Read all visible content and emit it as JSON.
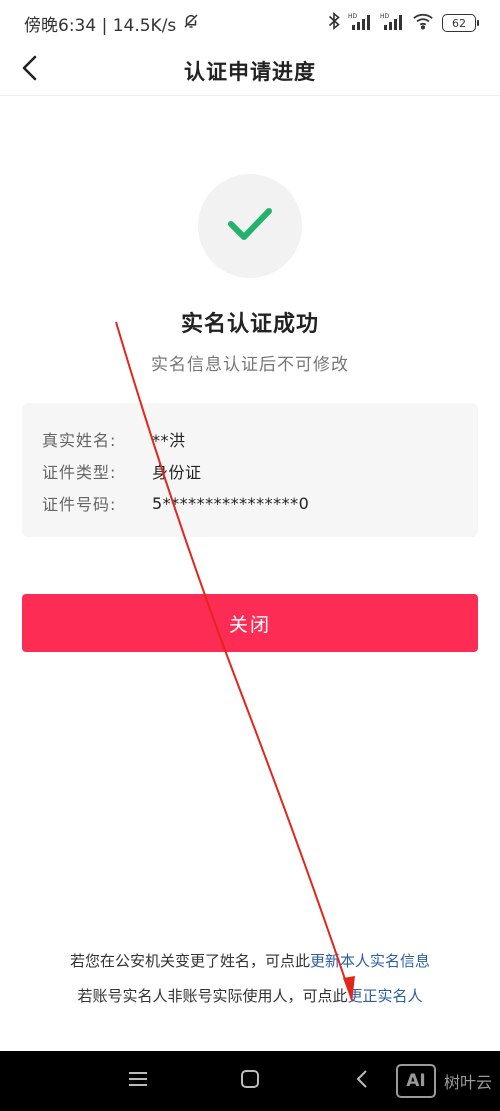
{
  "status_bar": {
    "time_speed": "傍晚6:34 | 14.5K/s",
    "battery": "62"
  },
  "header": {
    "title": "认证申请进度"
  },
  "success": {
    "title": "实名认证成功",
    "subtitle": "实名信息认证后不可修改"
  },
  "info": {
    "rows": [
      {
        "label": "真实姓名:",
        "value": "**洪"
      },
      {
        "label": "证件类型:",
        "value": "身份证"
      },
      {
        "label": "证件号码:",
        "value": "5****************0"
      }
    ]
  },
  "close_button": {
    "label": "关闭"
  },
  "notes": {
    "line1_prefix": "若您在公安机关变更了姓名，可点此",
    "line1_link": "更新本人实名信息",
    "line2_prefix": "若账号实名人非账号实际使用人，可点此",
    "line2_link": "更正实名人"
  },
  "watermark": {
    "box": "AI",
    "text": "树叶云"
  },
  "colors": {
    "accent": "#fd2c55",
    "success_check": "#22b36b",
    "link": "#2b5fa8",
    "annotation_arrow": "#e1261c"
  },
  "icons": {
    "back": "chevron-left-icon",
    "check": "check-icon",
    "mute": "bell-off-icon",
    "bluetooth": "bluetooth-icon",
    "signal": "signal-icon",
    "wifi": "wifi-icon",
    "menu": "menu-icon",
    "home": "home-square-icon",
    "nav_back": "nav-back-icon"
  }
}
